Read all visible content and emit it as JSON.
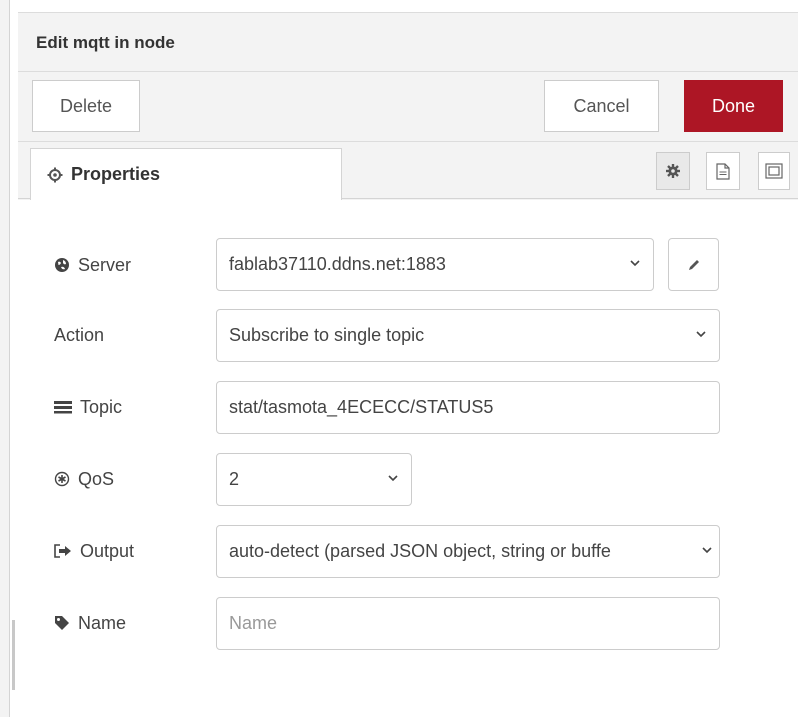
{
  "dialog": {
    "title": "Edit mqtt in node"
  },
  "toolbar": {
    "delete_label": "Delete",
    "cancel_label": "Cancel",
    "done_label": "Done"
  },
  "tabs": {
    "properties_label": "Properties"
  },
  "form": {
    "server": {
      "label": "Server",
      "value": "fablab37110.ddns.net:1883"
    },
    "action": {
      "label": "Action",
      "value": "Subscribe to single topic"
    },
    "topic": {
      "label": "Topic",
      "value": "stat/tasmota_4ECECC/STATUS5"
    },
    "qos": {
      "label": "QoS",
      "value": "2"
    },
    "output": {
      "label": "Output",
      "value": "auto-detect (parsed JSON object, string or buffe"
    },
    "name": {
      "label": "Name",
      "placeholder": "Name"
    }
  },
  "icons": {
    "properties": "cog-outline-icon",
    "server": "globe-icon",
    "topic": "list-icon",
    "qos": "asterisk-circle-icon",
    "output": "sign-out-icon",
    "name": "tag-icon",
    "edit": "pencil-icon",
    "chevron": "chevron-down-icon",
    "tab_settings": "gear-icon",
    "tab_description": "file-text-icon",
    "tab_appearance": "window-frame-icon"
  },
  "colors": {
    "done_button": "#ad1625",
    "panel_bg": "#f3f3f3",
    "border": "#cccccc"
  }
}
